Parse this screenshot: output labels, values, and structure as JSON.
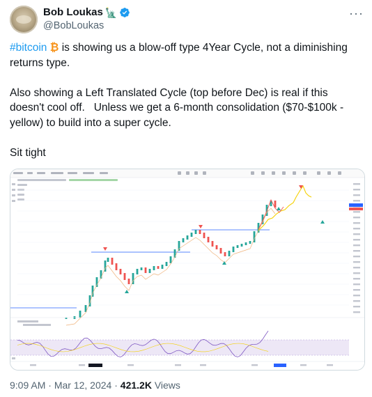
{
  "author": {
    "display_name": "Bob Loukas",
    "flag_emoji": "🗽",
    "handle": "@BobLoukas"
  },
  "tweet": {
    "hashtag": "#bitcoin",
    "btc_symbol": "₿",
    "line1_rest": " is showing us a blow-off type 4Year Cycle, not a diminishing returns type.",
    "para2": "Also showing a Left Translated Cycle (top before Dec) is real if this doesn't cool off.   Unless we get a 6-month consolidation ($70-$100k - yellow) to build into a super cycle.",
    "para3": "Sit tight"
  },
  "meta": {
    "time": "9:09 AM",
    "sep1": " · ",
    "date": "Mar 12, 2024",
    "sep2": " · ",
    "views_count": "421.2K",
    "views_label": " Views"
  },
  "colors": {
    "link": "#1d9bf0",
    "btc": "#f7931a",
    "verified": "#1d9bf0",
    "up_candle": "#26a69a",
    "down_candle": "#ef5350",
    "projection": "#f5d000",
    "rsi_line": "#7e57c2",
    "rsi_band": "#ede7f6"
  },
  "icons": {
    "verified": "verified-badge-icon",
    "more": "more-options-icon"
  }
}
